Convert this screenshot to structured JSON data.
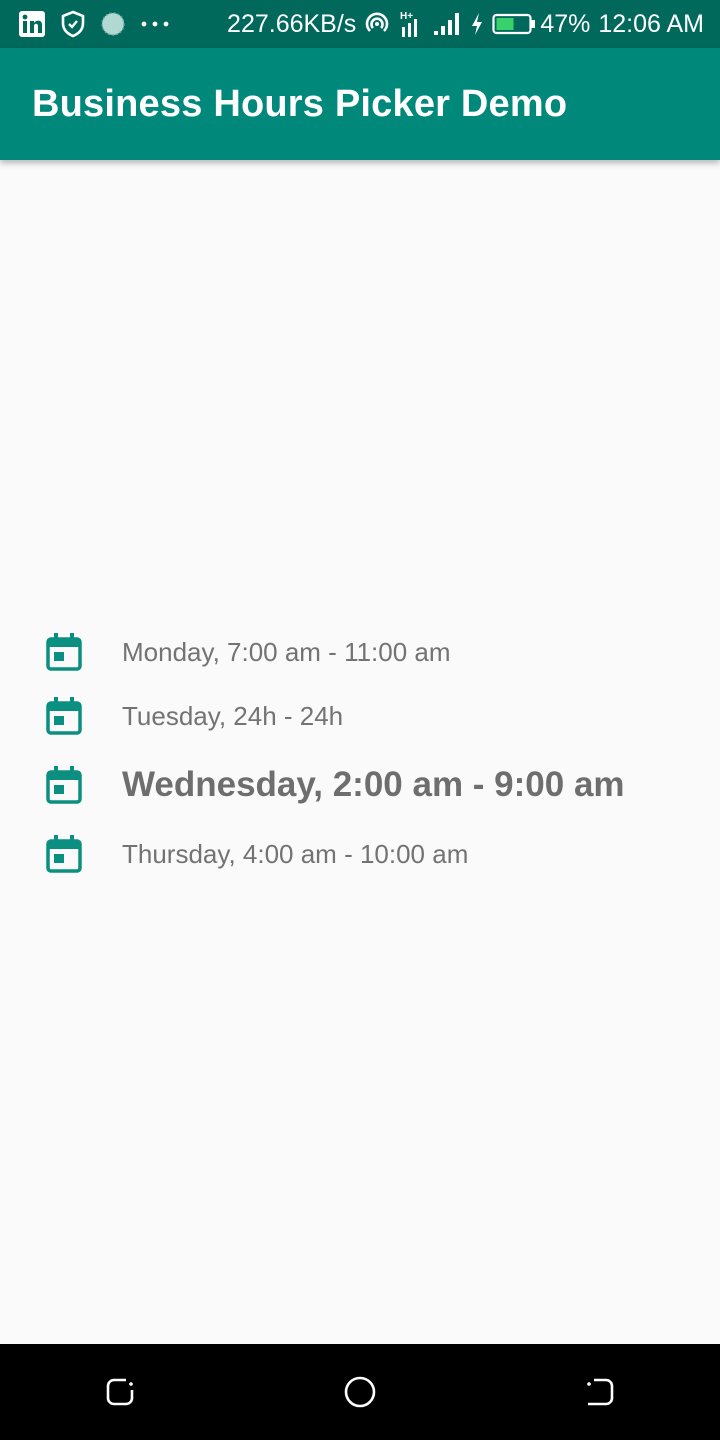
{
  "status_bar": {
    "net_speed": "227.66KB/s",
    "network_type": "H+",
    "battery": "47%",
    "time": "12:06 AM",
    "icons": [
      "linkedin-icon",
      "shield-icon",
      "globe-icon",
      "more-dots-icon",
      "hotspot-icon",
      "signal-h-icon",
      "signal-icon",
      "charging-icon",
      "battery-icon"
    ]
  },
  "app_bar": {
    "title": "Business Hours Picker Demo"
  },
  "hours": [
    {
      "text": "Monday, 7:00 am - 11:00 am"
    },
    {
      "text": "Tuesday, 24h - 24h"
    },
    {
      "text": "Wednesday, 2:00 am - 9:00 am"
    },
    {
      "text": "Thursday, 4:00 am - 10:00 am"
    }
  ],
  "nav_bar": {
    "icons": [
      "recents-icon",
      "home-icon",
      "back-icon"
    ]
  },
  "colors": {
    "primary": "#00897b",
    "primary_dark": "#00695c",
    "text_secondary": "#737373",
    "icon_teal": "#0a8f80"
  }
}
